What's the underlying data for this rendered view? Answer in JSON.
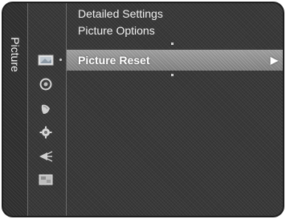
{
  "sidebar": {
    "category_label": "Picture",
    "icons": [
      "picture-icon",
      "sound-icon",
      "setup-icon",
      "input-icon",
      "application-icon",
      "support-icon"
    ]
  },
  "menu": {
    "items": [
      {
        "label": "Detailed Settings"
      },
      {
        "label": "Picture Options"
      },
      {
        "label": "Picture Reset",
        "selected": true,
        "arrow": "▶"
      }
    ]
  },
  "colors": {
    "background": "#383838",
    "highlight": "#8a8a8a",
    "text": "#f0f0f0"
  }
}
